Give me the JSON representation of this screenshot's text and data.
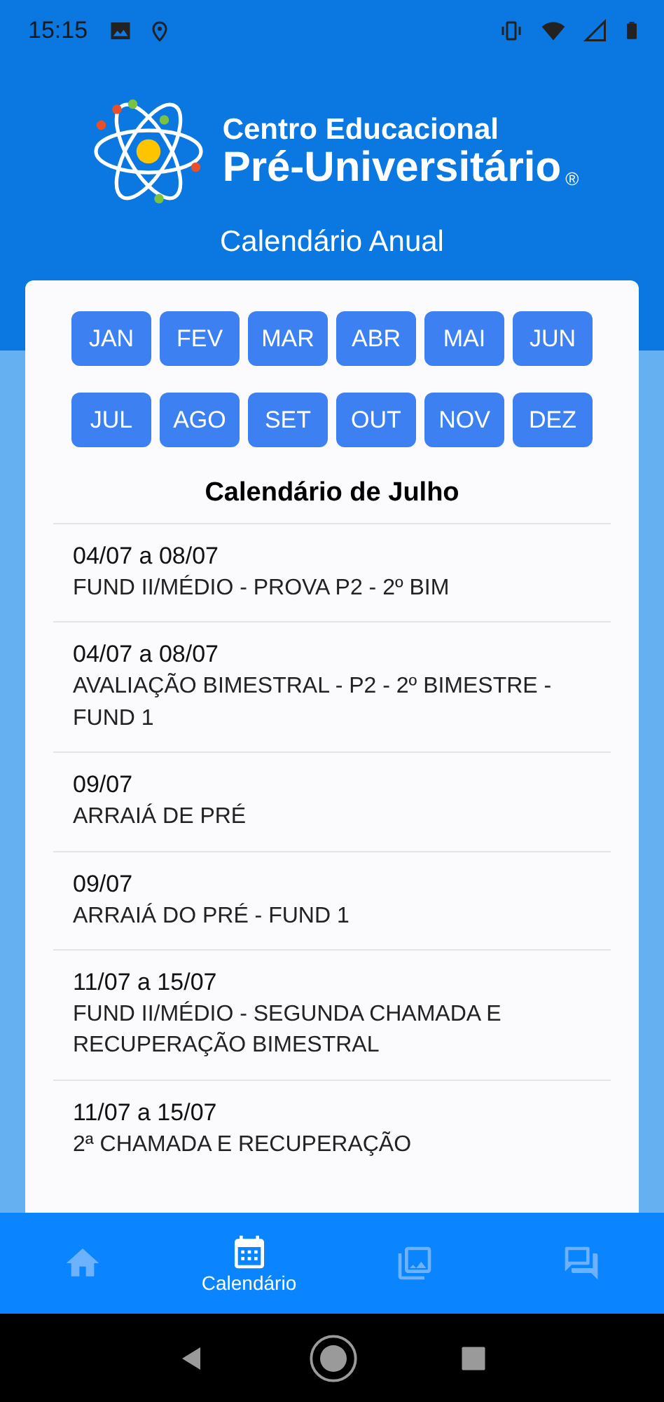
{
  "status_bar": {
    "time": "15:15"
  },
  "header": {
    "brand_line_1": "Centro Educacional",
    "brand_line_2": "Pré-Universitário",
    "registered": "®",
    "title": "Calendário Anual"
  },
  "months": [
    "JAN",
    "FEV",
    "MAR",
    "ABR",
    "MAI",
    "JUN",
    "JUL",
    "AGO",
    "SET",
    "OUT",
    "NOV",
    "DEZ"
  ],
  "calendar": {
    "title": "Calendário de Julho",
    "events": [
      {
        "date": "04/07 a 08/07",
        "description": "FUND II/MÉDIO - PROVA P2 - 2º BIM"
      },
      {
        "date": "04/07 a 08/07",
        "description": "AVALIAÇÃO BIMESTRAL - P2 - 2º BIMESTRE - FUND 1"
      },
      {
        "date": "09/07",
        "description": "ARRAIÁ DE PRÉ"
      },
      {
        "date": "09/07",
        "description": "ARRAIÁ DO PRÉ - FUND 1"
      },
      {
        "date": "11/07 a 15/07",
        "description": "FUND II/MÉDIO - SEGUNDA CHAMADA E RECUPERAÇÃO BIMESTRAL"
      },
      {
        "date": "11/07 a 15/07",
        "description": "2ª CHAMADA E RECUPERAÇÃO"
      }
    ]
  },
  "bottom_nav": [
    {
      "kind": "home",
      "selected": false
    },
    {
      "kind": "calendar",
      "selected": true,
      "label": "Calendário"
    },
    {
      "kind": "gallery",
      "selected": false
    },
    {
      "kind": "chat",
      "selected": false
    }
  ]
}
